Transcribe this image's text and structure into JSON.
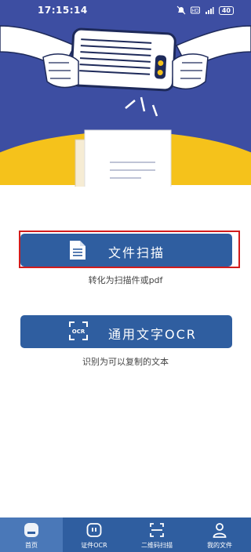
{
  "status_bar": {
    "time": "17:15:14",
    "battery": "40",
    "icons": [
      "mute-icon",
      "hd-icon",
      "signal-icon",
      "battery-icon"
    ]
  },
  "colors": {
    "primary": "#2f5ea0",
    "hero_bg": "#3d4ea2",
    "hero_accent": "#f5c21b",
    "highlight": "#d21c1c"
  },
  "main": {
    "scan_button": {
      "label": "文件扫描",
      "caption": "转化为扫描件或pdf",
      "icon": "document-icon"
    },
    "ocr_button": {
      "label": "通用文字OCR",
      "caption": "识别为可以复制的文本",
      "icon": "ocr-scan-icon"
    }
  },
  "bottom_nav": {
    "items": [
      {
        "label": "首页",
        "icon": "home-icon",
        "active": true
      },
      {
        "label": "证件OCR",
        "icon": "id-card-icon",
        "active": false
      },
      {
        "label": "二维码扫描",
        "icon": "qr-scan-icon",
        "active": false
      },
      {
        "label": "我的文件",
        "icon": "user-icon",
        "active": false
      }
    ]
  }
}
